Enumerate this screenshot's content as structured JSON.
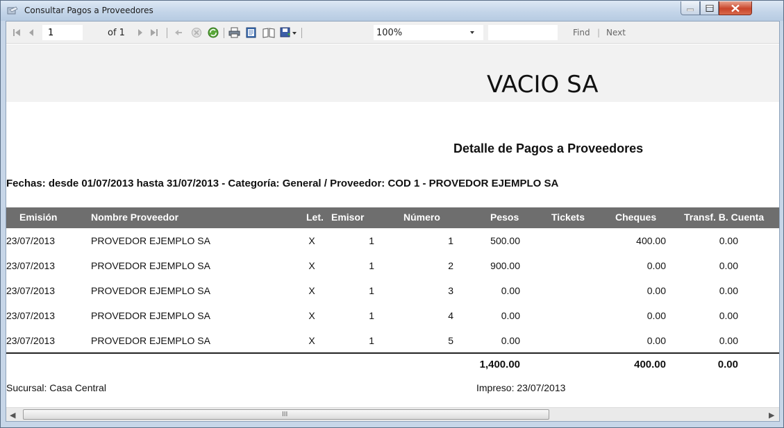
{
  "window": {
    "title": "Consultar Pagos a Proveedores",
    "close_color": "#c9452b"
  },
  "toolbar": {
    "page_current": "1",
    "page_of": "of 1",
    "zoom": "100%",
    "find_value": "",
    "find_label": "Find",
    "find_separator": "|",
    "next_label": "Next"
  },
  "report": {
    "company": "VACIO SA",
    "title": "Detalle de Pagos a Proveedores",
    "filters": "Fechas: desde 01/07/2013 hasta 31/07/2013 - Categoría: General / Proveedor: COD 1 - PROVEDOR EJEMPLO SA",
    "header_color": "#6e6e6e",
    "columns": [
      "Emisión",
      "Nombre Proveedor",
      "Let.",
      "Emisor",
      "Número",
      "Pesos",
      "Tickets",
      "Cheques",
      "Transf. B. Cuenta"
    ],
    "rows": [
      [
        "23/07/2013",
        "PROVEDOR EJEMPLO SA",
        "X",
        "1",
        "1",
        "500.00",
        "",
        "400.00",
        "0.00"
      ],
      [
        "23/07/2013",
        "PROVEDOR EJEMPLO SA",
        "X",
        "1",
        "2",
        "900.00",
        "",
        "0.00",
        "0.00"
      ],
      [
        "23/07/2013",
        "PROVEDOR EJEMPLO SA",
        "X",
        "1",
        "3",
        "0.00",
        "",
        "0.00",
        "0.00"
      ],
      [
        "23/07/2013",
        "PROVEDOR EJEMPLO SA",
        "X",
        "1",
        "4",
        "0.00",
        "",
        "0.00",
        "0.00"
      ],
      [
        "23/07/2013",
        "PROVEDOR EJEMPLO SA",
        "X",
        "1",
        "5",
        "0.00",
        "",
        "0.00",
        "0.00"
      ]
    ],
    "totals": {
      "pesos": "1,400.00",
      "cheques": "400.00",
      "transf": "0.00"
    },
    "sucursal": "Sucursal: Casa Central",
    "impreso": "Impreso: 23/07/2013"
  },
  "scrollbar": {
    "left_arrow": "◀",
    "right_arrow": "▶",
    "grip": "III"
  }
}
